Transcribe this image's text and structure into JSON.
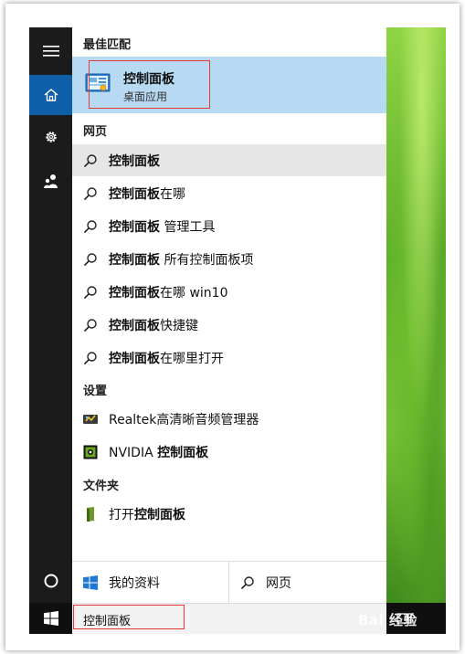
{
  "best_match": {
    "section_title": "最佳匹配",
    "title": "控制面板",
    "subtitle": "桌面应用"
  },
  "web": {
    "section_title": "网页",
    "items": [
      {
        "bold": "控制面板",
        "rest": ""
      },
      {
        "bold": "控制面板",
        "rest": "在哪"
      },
      {
        "bold": "控制面板",
        "rest": " 管理工具"
      },
      {
        "bold": "控制面板",
        "rest": " 所有控制面板项"
      },
      {
        "bold": "控制面板",
        "rest": "在哪 win10"
      },
      {
        "bold": "控制面板",
        "rest": "快捷键"
      },
      {
        "bold": "控制面板",
        "rest": "在哪里打开"
      }
    ]
  },
  "settings": {
    "section_title": "设置",
    "items": [
      {
        "prefix": "Realtek高清晰音频管理器",
        "bold": ""
      },
      {
        "prefix": "NVIDIA ",
        "bold": "控制面板"
      }
    ]
  },
  "folders": {
    "section_title": "文件夹",
    "items": [
      {
        "prefix": "打开",
        "bold": "控制面板"
      }
    ]
  },
  "bottom_bar": {
    "my_stuff": "我的资料",
    "web": "网页"
  },
  "taskbar": {
    "search_query": "控制面板"
  },
  "watermark": "Bai 经验",
  "colors": {
    "accent": "#0e5fa8",
    "best_match_bg": "#b7d9f2",
    "annotation_red": "#e23a3a"
  },
  "icons": {
    "rail": [
      "hamburger-menu-icon",
      "home-icon",
      "gear-icon",
      "people-icon",
      "cortana-circle-icon"
    ],
    "start": "windows-logo-icon"
  }
}
